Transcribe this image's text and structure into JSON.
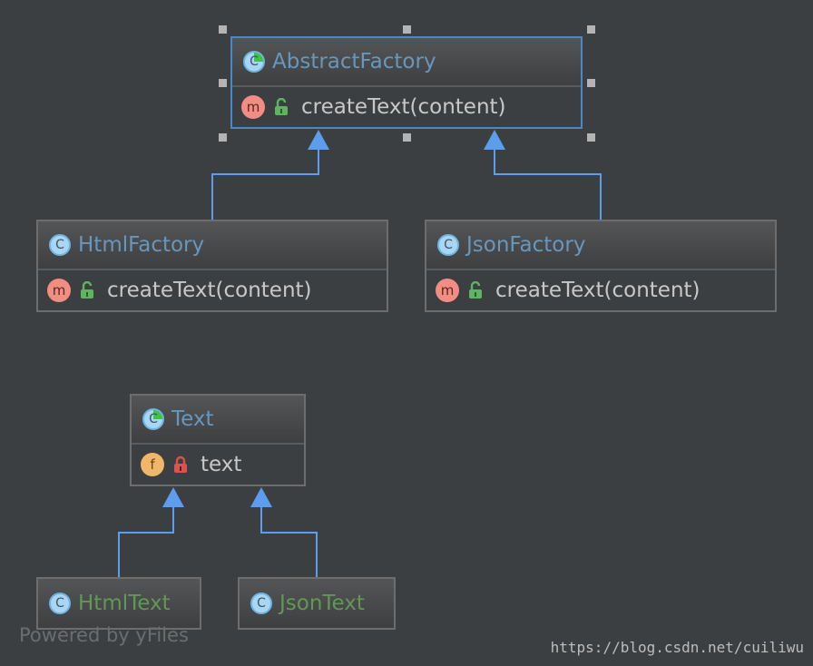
{
  "diagram": {
    "nodes": [
      {
        "id": "abstract_factory",
        "name": "AbstractFactory",
        "kind": "abstract-class",
        "members": [
          {
            "kind": "method",
            "visibility": "public",
            "label": "createText(content)"
          }
        ],
        "selected": true
      },
      {
        "id": "html_factory",
        "name": "HtmlFactory",
        "kind": "class",
        "members": [
          {
            "kind": "method",
            "visibility": "public",
            "label": "createText(content)"
          }
        ]
      },
      {
        "id": "json_factory",
        "name": "JsonFactory",
        "kind": "class",
        "members": [
          {
            "kind": "method",
            "visibility": "public",
            "label": "createText(content)"
          }
        ]
      },
      {
        "id": "text",
        "name": "Text",
        "kind": "abstract-class",
        "members": [
          {
            "kind": "field",
            "visibility": "private",
            "label": "text"
          }
        ]
      },
      {
        "id": "html_text",
        "name": "HtmlText",
        "kind": "class",
        "members": []
      },
      {
        "id": "json_text",
        "name": "JsonText",
        "kind": "class",
        "members": []
      }
    ],
    "edges": [
      {
        "from": "html_factory",
        "to": "abstract_factory",
        "type": "inheritance"
      },
      {
        "from": "json_factory",
        "to": "abstract_factory",
        "type": "inheritance"
      },
      {
        "from": "html_text",
        "to": "text",
        "type": "inheritance"
      },
      {
        "from": "json_text",
        "to": "text",
        "type": "inheritance"
      }
    ],
    "icons": {
      "class": "C",
      "method": "m",
      "field": "f"
    }
  },
  "footer": "Powered by yFiles",
  "watermark": "https://blog.csdn.net/cuiliwu",
  "colors": {
    "background": "#3c3f41",
    "class_name": "#6897bb",
    "leaf_class_name": "#629755",
    "selection": "#4a88c7",
    "edge": "#5c9ded"
  }
}
